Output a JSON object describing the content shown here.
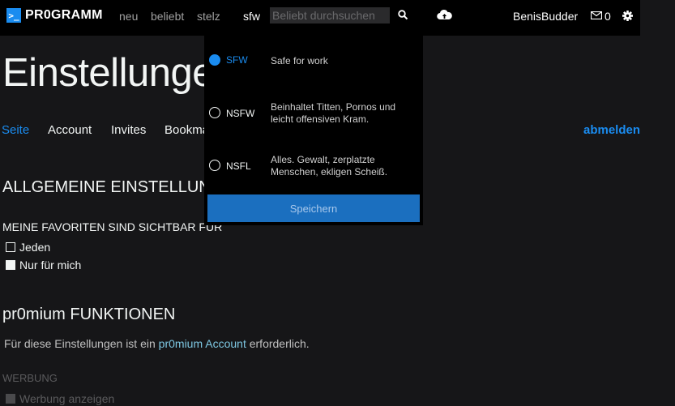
{
  "header": {
    "logo_mark": ">_",
    "logo_text": "PR0GRAMM",
    "nav": [
      "neu",
      "beliebt",
      "stelz"
    ],
    "filter_label": "sfw",
    "search_placeholder": "Beliebt durchsuchen",
    "username": "BenisBudder",
    "message_count": "0"
  },
  "page": {
    "title": "Einstellungen",
    "tabs": [
      "Seite",
      "Account",
      "Invites",
      "Bookmarklet"
    ],
    "active_tab": "Seite",
    "logout": "abmelden"
  },
  "general": {
    "heading": "ALLGEMEINE EINSTELLUNGEN",
    "favorites_heading": "MEINE FAVORITEN SIND SICHTBAR FÜR",
    "options": [
      {
        "label": "Jeden",
        "checked": false
      },
      {
        "label": "Nur für mich",
        "checked": true
      }
    ]
  },
  "premium": {
    "heading": "pr0mium FUNKTIONEN",
    "info_before": "Für diese Einstellungen ist ein ",
    "info_link": "pr0mium Account",
    "info_after": " erforderlich.",
    "ads_heading": "WERBUNG",
    "ads_option": "Werbung anzeigen"
  },
  "filter_dropdown": {
    "options": [
      {
        "label": "SFW",
        "desc": "Safe for work",
        "selected": true
      },
      {
        "label": "NSFW",
        "desc": "Beinhaltet Titten, Pornos und leicht offensiven Kram.",
        "selected": false
      },
      {
        "label": "NSFL",
        "desc": "Alles. Gewalt, zerplatzte Menschen, ekligen Scheiß.",
        "selected": false
      }
    ],
    "save_label": "Speichern"
  },
  "colors": {
    "accent": "#1a8cf0",
    "background": "#161618",
    "topbar": "#000000",
    "link_premium": "#7ec8e3",
    "save_button": "#1b6fbf"
  }
}
